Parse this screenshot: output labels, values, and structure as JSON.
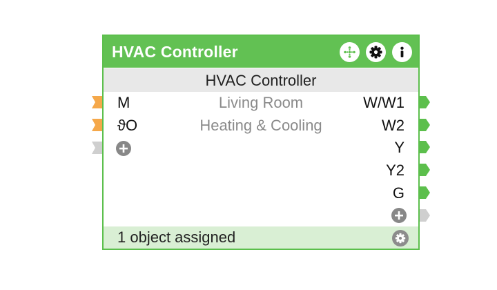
{
  "block": {
    "title": "HVAC Controller",
    "subtitle": "HVAC Controller",
    "header_buttons": [
      {
        "icon": "move-icon"
      },
      {
        "icon": "gear-icon"
      },
      {
        "icon": "info-icon"
      }
    ],
    "inputs": [
      {
        "label": "M",
        "port_color": "#f5a84a"
      },
      {
        "label": "ϑO",
        "port_color": "#f5a84a"
      },
      {
        "label": "",
        "port_color": "#cfcfcf",
        "add": true
      }
    ],
    "center_labels": [
      "Living Room",
      "Heating & Cooling"
    ],
    "outputs": [
      {
        "label": "W/W1",
        "port_color": "#5cbf4c"
      },
      {
        "label": "W2",
        "port_color": "#5cbf4c"
      },
      {
        "label": "Y",
        "port_color": "#5cbf4c"
      },
      {
        "label": "Y2",
        "port_color": "#5cbf4c"
      },
      {
        "label": "G",
        "port_color": "#5cbf4c"
      },
      {
        "label": "",
        "port_color": "#cfcfcf",
        "add": true
      }
    ],
    "footer_text": "1 object assigned"
  },
  "colors": {
    "header_green": "#62c153",
    "border_green": "#5cbf4c",
    "footer_green": "#d9efd4",
    "subtitle_gray": "#e8e8e8",
    "input_orange": "#f5a84a"
  }
}
